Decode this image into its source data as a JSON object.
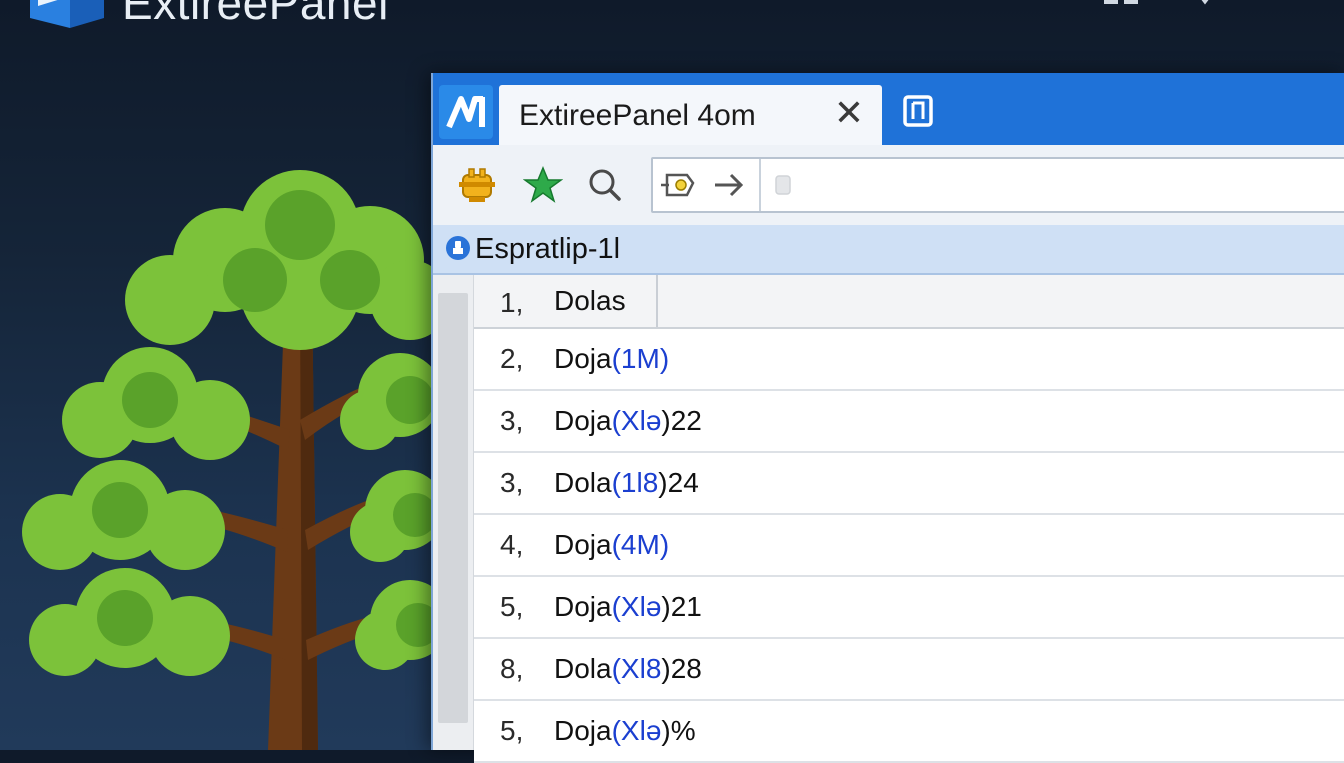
{
  "desktop": {
    "title": "ExtireePanel"
  },
  "window": {
    "tab_label": "ExtireePanel   4om",
    "tab_close_glyph": "✕",
    "address_placeholder": "",
    "section_title": "Espratlip-1l"
  },
  "list": {
    "header": {
      "num": "1,",
      "name": "Dolas"
    },
    "rows": [
      {
        "num": "2,",
        "prefix": "Doja",
        "highlight": "(1M)",
        "suffix": ""
      },
      {
        "num": "3,",
        "prefix": "Doja",
        "highlight": "(Xlə",
        "suffix": ")22"
      },
      {
        "num": "3,",
        "prefix": "Dola",
        "highlight": "(1l8",
        "suffix": ")24"
      },
      {
        "num": "4,",
        "prefix": "Doja",
        "highlight": "(4M)",
        "suffix": ""
      },
      {
        "num": "5,",
        "prefix": "Doja",
        "highlight": "(Xlə",
        "suffix": ")21"
      },
      {
        "num": "8,",
        "prefix": "Dola",
        "highlight": "(Xl8",
        "suffix": ")28"
      },
      {
        "num": "5,",
        "prefix": "Doja",
        "highlight": "(Xlə",
        "suffix": ")%"
      }
    ]
  },
  "icons": {
    "app_logo": "app-logo-icon",
    "new_tab": "new-tab-icon",
    "plugin": "plugin-icon",
    "star": "star-icon",
    "search": "search-icon",
    "key": "key-icon",
    "forward": "arrow-right-icon",
    "section": "info-icon"
  },
  "colors": {
    "titlebar": "#1f72d8",
    "section_header": "#cfe0f5",
    "highlight_text": "#1b3fd0",
    "tree_leaves": "#7cc23a",
    "tree_trunk": "#6b3a16"
  }
}
